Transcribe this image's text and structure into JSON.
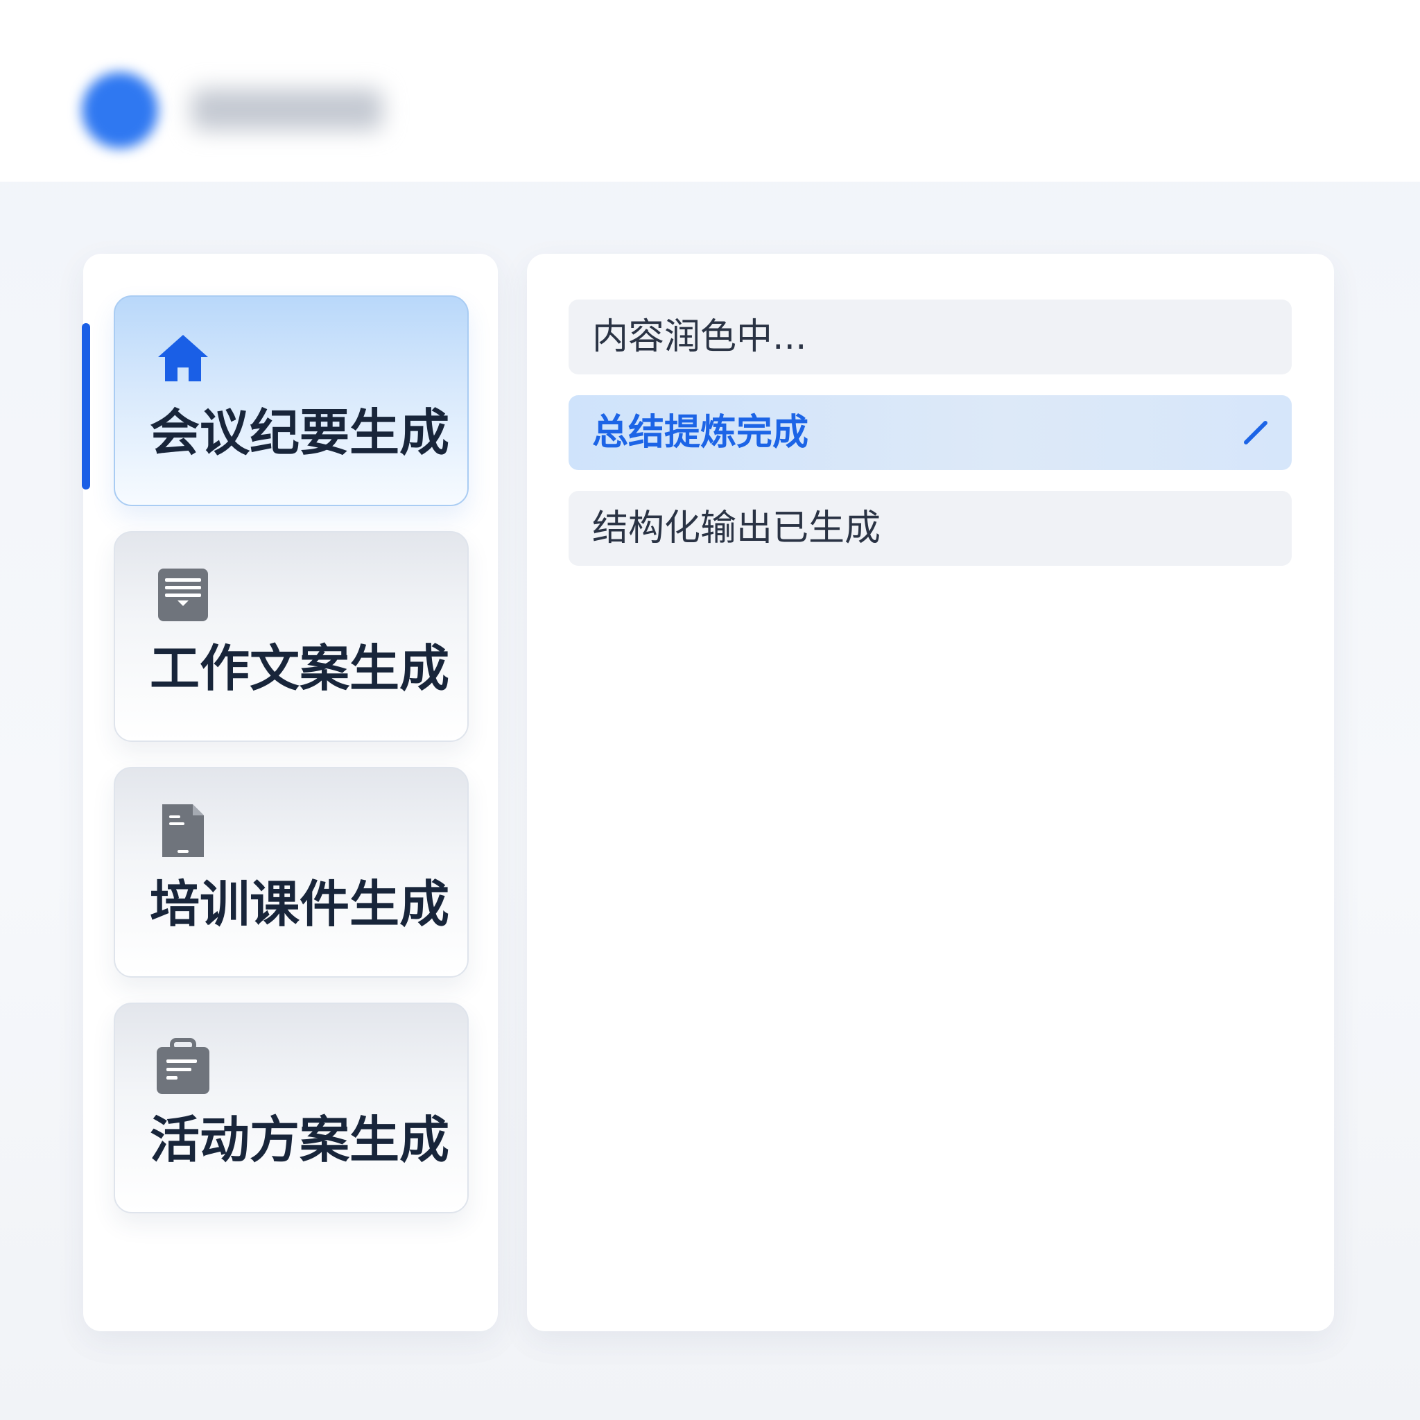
{
  "colors": {
    "accent": "#1a5fe6",
    "active_card_bg": "#d8e9fc",
    "done_item_text": "#1c64e6",
    "title_text": "#18253a",
    "icon_gray": "#6f747c"
  },
  "sidebar": {
    "items": [
      {
        "label": "会议纪要生成",
        "icon": "home-icon",
        "active": true
      },
      {
        "label": "工作文案生成",
        "icon": "note-icon",
        "active": false
      },
      {
        "label": "培训课件生成",
        "icon": "document-icon",
        "active": false
      },
      {
        "label": "活动方案生成",
        "icon": "briefcase-icon",
        "active": false
      }
    ]
  },
  "main": {
    "status_items": [
      {
        "text": "内容润色中...",
        "state": "in-progress"
      },
      {
        "text": "总结提炼完成",
        "state": "done",
        "icon": "check-icon"
      },
      {
        "text": "结构化输出已生成",
        "state": "pending"
      }
    ]
  }
}
